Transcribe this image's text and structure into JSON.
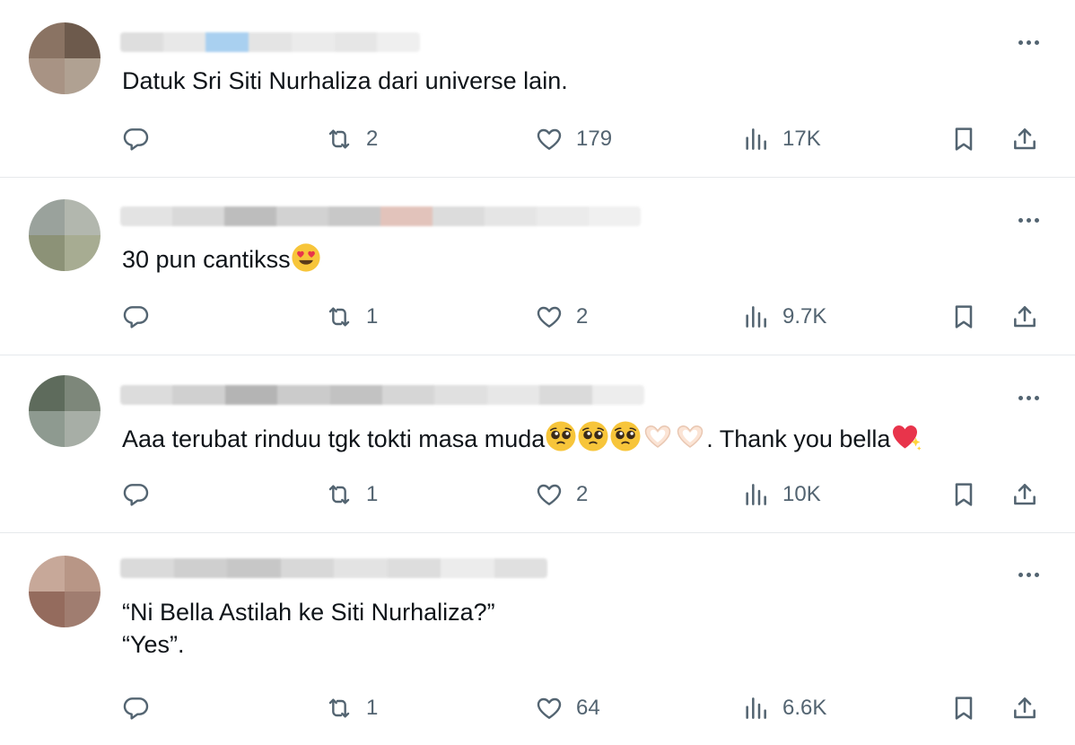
{
  "colors": {
    "text": "#0f1419",
    "muted": "#536471",
    "divider": "#e6e9ec"
  },
  "icons": {
    "reply": "reply-icon",
    "retweet": "retweet-icon",
    "like": "heart-icon",
    "views": "views-bar-chart-icon",
    "bookmark": "bookmark-icon",
    "share": "share-icon",
    "more": "more-dots-icon"
  },
  "replies": [
    {
      "text": "Datuk Sri Siti Nurhaliza dari universe lain.",
      "retweets": "2",
      "likes": "179",
      "views": "17K"
    },
    {
      "text": "30 pun cantikss",
      "emoji_after": [
        "heart-eyes-face-emoji"
      ],
      "retweets": "1",
      "likes": "2",
      "views": "9.7K"
    },
    {
      "text_part1": "Aaa terubat rinduu tgk tokti masa muda",
      "text_part2": ". Thank you bella",
      "emoji_mid": [
        "pleading-face-emoji",
        "pleading-face-emoji",
        "pleading-face-emoji",
        "heart-hands-emoji",
        "heart-hands-emoji"
      ],
      "emoji_end": [
        "sparkling-heart-emoji"
      ],
      "retweets": "1",
      "likes": "2",
      "views": "10K"
    },
    {
      "line1": "“Ni Bella Astilah ke Siti Nurhaliza?”",
      "line2": "“Yes”.",
      "retweets": "1",
      "likes": "64",
      "views": "6.6K"
    }
  ]
}
